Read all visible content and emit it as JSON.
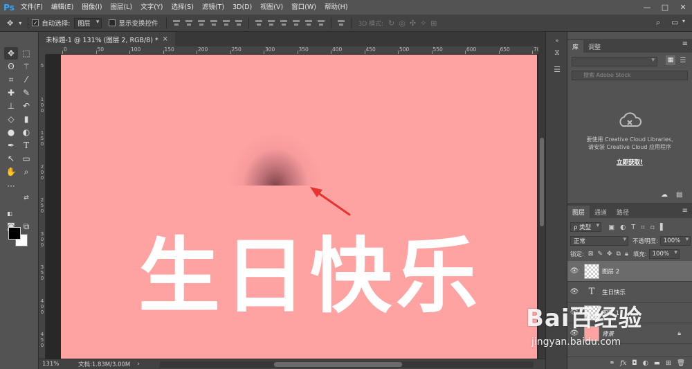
{
  "app": {
    "logo": "Ps",
    "menu": [
      "文件(F)",
      "编辑(E)",
      "图像(I)",
      "图层(L)",
      "文字(Y)",
      "选择(S)",
      "滤镜(T)",
      "3D(D)",
      "视图(V)",
      "窗口(W)",
      "帮助(H)"
    ],
    "window_controls": [
      "—",
      "□",
      "✕"
    ]
  },
  "options": {
    "auto_select_label": "自动选择:",
    "auto_select_checked": true,
    "auto_select_target": "图层",
    "show_transform_label": "显示变换控件",
    "mode3d_label": "3D 模式:"
  },
  "document": {
    "tab_title": "未标题-1 @ 131% (图层 2, RGB/8) *",
    "tab_close": "×",
    "canvas_text": "生日快乐",
    "canvas_color": "#ffa2a2",
    "ruler_top": [
      "0",
      "50",
      "100",
      "150",
      "200",
      "250",
      "300",
      "350",
      "400",
      "450",
      "500",
      "550",
      "600",
      "650",
      "700"
    ],
    "ruler_left": [
      "5",
      "1 0 0",
      "1 5 0",
      "2 0 0",
      "2 5 0",
      "3 0 0",
      "3 5 0",
      "4 0 0",
      "4 5 0",
      "5 0 0"
    ]
  },
  "status": {
    "zoom": "131%",
    "doc_size": "文档:1.83M/3.00M",
    "nav_arrow": "›"
  },
  "panels": {
    "library": {
      "tabs": [
        "库",
        "调整"
      ],
      "search_placeholder": "搜索 Adobe Stock",
      "message_line1": "要使用 Creative Cloud Libraries,",
      "message_line2": "请安装 Creative Cloud 应用程序",
      "get_now": "立即获取!"
    },
    "layers": {
      "tabs": [
        "图层",
        "通道",
        "路径"
      ],
      "filter_kind": "ρ 类型",
      "blend_mode": "正常",
      "opacity_label": "不透明度:",
      "opacity_value": "100%",
      "lock_label": "锁定:",
      "fill_label": "填充:",
      "fill_value": "100%",
      "items": [
        {
          "name": "图层 2",
          "type": "pixel",
          "active": true
        },
        {
          "name": "生日快乐",
          "type": "text",
          "active": false
        },
        {
          "name": "图层 1",
          "type": "pixel",
          "active": false
        },
        {
          "name": "背景",
          "type": "background",
          "active": false
        }
      ]
    }
  },
  "watermark": {
    "logo": "Bai百经验",
    "url": "jingyan.baidu.com"
  }
}
